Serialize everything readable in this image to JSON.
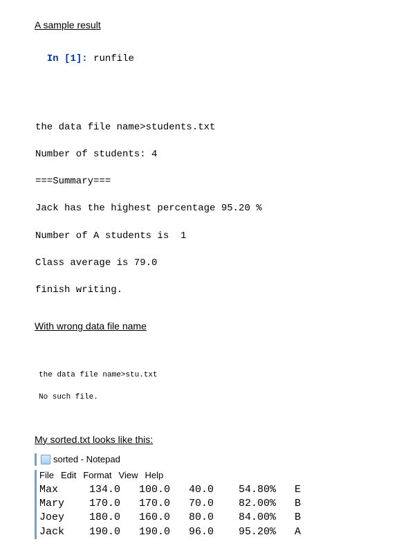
{
  "heading_sample": "A sample result",
  "console1": {
    "prompt": {
      "in": "In ",
      "open": "[",
      "num": "1",
      "close": "]",
      "colon": ": "
    },
    "cmd": "runfile",
    "lines": [
      "the data file name>students.txt",
      "Number of students: 4",
      "===Summary===",
      "Jack has the highest percentage 95.20 %",
      "Number of A students is  1",
      "Class average is 79.0",
      "finish writing."
    ]
  },
  "heading_wrong": "With wrong data file name",
  "console2": {
    "lines": [
      "the data file name>stu.txt",
      "No such file."
    ]
  },
  "heading_sorted": "My sorted.txt looks like this:",
  "notepad": {
    "title": "sorted - Notepad",
    "menu": [
      "File",
      "Edit",
      "Format",
      "View",
      "Help"
    ],
    "rows": [
      {
        "name": "Max",
        "c1": "134.0",
        "c2": "100.0",
        "c3": "40.0",
        "pct": "54.80%",
        "g": "E"
      },
      {
        "name": "Mary",
        "c1": "170.0",
        "c2": "170.0",
        "c3": "70.0",
        "pct": "82.00%",
        "g": "B"
      },
      {
        "name": "Joey",
        "c1": "180.0",
        "c2": "160.0",
        "c3": "80.0",
        "pct": "84.00%",
        "g": "B"
      },
      {
        "name": "Jack",
        "c1": "190.0",
        "c2": "190.0",
        "c3": "96.0",
        "pct": "95.20%",
        "g": "A"
      }
    ]
  }
}
